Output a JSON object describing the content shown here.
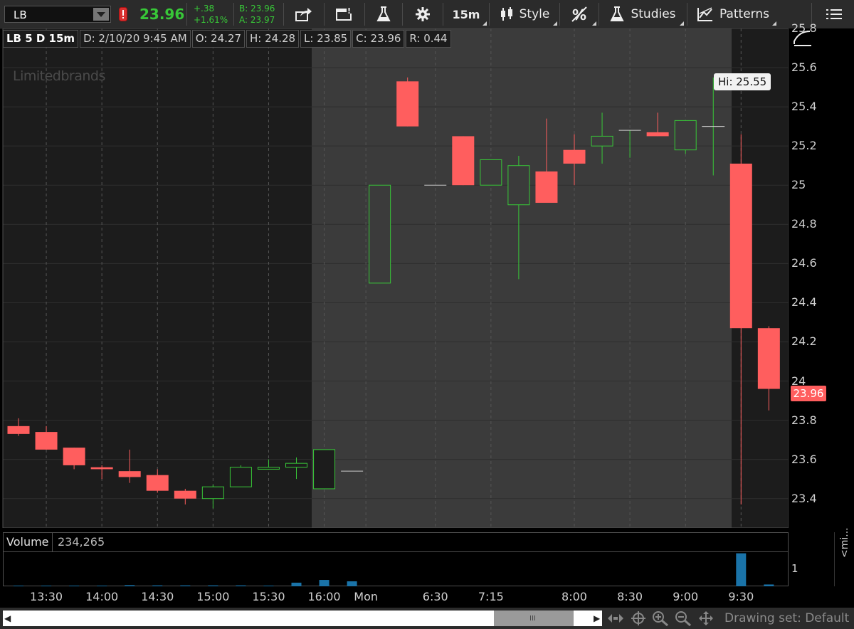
{
  "toolbar": {
    "symbol": "LB",
    "last_price": "23.96",
    "change": "+.38",
    "change_pct": "+1.61%",
    "bid": "B: 23.96",
    "ask": "A: 23.97",
    "timeframe": "15m",
    "style_label": "Style",
    "studies_label": "Studies",
    "patterns_label": "Patterns",
    "colors": {
      "up": "#38c738",
      "down": "#ff5e5e",
      "alert": "#d93030"
    }
  },
  "infobar": {
    "symbol_period": "LB 5 D 15m",
    "date": "D: 2/10/20 9:45 AM",
    "open": "O: 24.27",
    "high": "H: 24.28",
    "low": "L: 23.85",
    "close": "C: 23.96",
    "range": "R: 0.44"
  },
  "chart": {
    "watermark": "Limitedbrands",
    "hi_label": "Hi: 25.55",
    "last_price_tag": "23.96",
    "yticks": [
      {
        "value": 25.8,
        "label": "25.8"
      },
      {
        "value": 25.6,
        "label": "25.6"
      },
      {
        "value": 25.4,
        "label": "25.4"
      },
      {
        "value": 25.2,
        "label": "25.2"
      },
      {
        "value": 25.0,
        "label": "25"
      },
      {
        "value": 24.8,
        "label": "24.8"
      },
      {
        "value": 24.6,
        "label": "24.6"
      },
      {
        "value": 24.4,
        "label": "24.4"
      },
      {
        "value": 24.2,
        "label": "24.2"
      },
      {
        "value": 24.0,
        "label": "24"
      },
      {
        "value": 23.8,
        "label": "23.8"
      },
      {
        "value": 23.6,
        "label": "23.6"
      },
      {
        "value": 23.4,
        "label": "23.4"
      }
    ],
    "xticks": [
      "13:30",
      "14:00",
      "14:30",
      "15:00",
      "15:30",
      "16:00",
      "Mon",
      "6:30",
      "7:15",
      "8:00",
      "8:30",
      "9:00",
      "9:30"
    ]
  },
  "chart_data": {
    "type": "candlestick",
    "ylim": [
      23.25,
      25.8
    ],
    "candles": [
      {
        "time": "13:15",
        "open": 23.77,
        "high": 23.81,
        "low": 23.72,
        "close": 23.73
      },
      {
        "time": "13:30",
        "open": 23.74,
        "high": 23.77,
        "low": 23.65,
        "close": 23.65
      },
      {
        "time": "13:45",
        "open": 23.66,
        "high": 23.66,
        "low": 23.55,
        "close": 23.57
      },
      {
        "time": "14:00",
        "open": 23.56,
        "high": 23.57,
        "low": 23.5,
        "close": 23.55
      },
      {
        "time": "14:15",
        "open": 23.54,
        "high": 23.65,
        "low": 23.48,
        "close": 23.51
      },
      {
        "time": "14:30",
        "open": 23.52,
        "high": 23.55,
        "low": 23.43,
        "close": 23.44
      },
      {
        "time": "14:45",
        "open": 23.44,
        "high": 23.45,
        "low": 23.37,
        "close": 23.4
      },
      {
        "time": "15:00",
        "open": 23.4,
        "high": 23.47,
        "low": 23.35,
        "close": 23.46
      },
      {
        "time": "15:15",
        "open": 23.46,
        "high": 23.57,
        "low": 23.46,
        "close": 23.56
      },
      {
        "time": "15:30",
        "open": 23.55,
        "high": 23.6,
        "low": 23.55,
        "close": 23.56
      },
      {
        "time": "15:45",
        "open": 23.56,
        "high": 23.61,
        "low": 23.5,
        "close": 23.58
      },
      {
        "time": "16:00",
        "open": 23.45,
        "high": 23.65,
        "low": 23.45,
        "close": 23.65
      },
      {
        "time": "16:15",
        "open": 23.54,
        "high": 23.54,
        "low": 23.54,
        "close": 23.54
      },
      {
        "time": "6:15",
        "open": 24.5,
        "high": 25.0,
        "low": 24.5,
        "close": 25.0
      },
      {
        "time": "6:30",
        "open": 25.53,
        "high": 25.55,
        "low": 25.3,
        "close": 25.3
      },
      {
        "time": "6:45",
        "open": 25.0,
        "high": 25.0,
        "low": 25.0,
        "close": 25.0
      },
      {
        "time": "7:00",
        "open": 25.25,
        "high": 25.25,
        "low": 25.0,
        "close": 25.0
      },
      {
        "time": "7:15",
        "open": 25.0,
        "high": 25.13,
        "low": 25.0,
        "close": 25.13
      },
      {
        "time": "7:30",
        "open": 24.9,
        "high": 25.15,
        "low": 24.52,
        "close": 25.1
      },
      {
        "time": "7:45",
        "open": 25.07,
        "high": 25.34,
        "low": 24.91,
        "close": 24.91
      },
      {
        "time": "8:00",
        "open": 25.18,
        "high": 25.26,
        "low": 25.0,
        "close": 25.11
      },
      {
        "time": "8:15",
        "open": 25.2,
        "high": 25.37,
        "low": 25.11,
        "close": 25.25
      },
      {
        "time": "8:30",
        "open": 25.28,
        "high": 25.28,
        "low": 25.14,
        "close": 25.28
      },
      {
        "time": "8:45",
        "open": 25.27,
        "high": 25.37,
        "low": 25.25,
        "close": 25.25
      },
      {
        "time": "9:00",
        "open": 25.18,
        "high": 25.33,
        "low": 25.16,
        "close": 25.33
      },
      {
        "time": "9:15",
        "open": 25.3,
        "high": 25.55,
        "low": 25.05,
        "close": 25.3
      },
      {
        "time": "9:30",
        "open": 25.11,
        "high": 25.26,
        "low": 23.37,
        "close": 24.27
      },
      {
        "time": "9:45",
        "open": 24.27,
        "high": 24.28,
        "low": 23.85,
        "close": 23.96
      }
    ],
    "volume": {
      "label": "Volume",
      "value": "234,265",
      "ytick": "1",
      "ylim": [
        0,
        1.5
      ]
    }
  },
  "scrollbar": {
    "drawing_set": "Drawing set: Default",
    "vertical_tab": "<mi..."
  }
}
